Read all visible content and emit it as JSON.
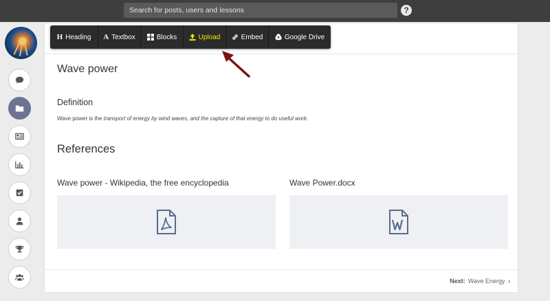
{
  "header": {
    "search_placeholder": "Search for posts, users and lessons",
    "help_label": "?"
  },
  "sidebar": {
    "items": [
      {
        "name": "comments",
        "icon": "comment-icon",
        "active": false
      },
      {
        "name": "lessons",
        "icon": "folder-icon",
        "active": true
      },
      {
        "name": "news",
        "icon": "newspaper-icon",
        "active": false
      },
      {
        "name": "stats",
        "icon": "bar-chart-icon",
        "active": false
      },
      {
        "name": "tasks",
        "icon": "checkbox-icon",
        "active": false
      },
      {
        "name": "profile",
        "icon": "user-icon",
        "active": false
      },
      {
        "name": "awards",
        "icon": "trophy-icon",
        "active": false
      },
      {
        "name": "groups",
        "icon": "users-icon",
        "active": false
      }
    ]
  },
  "toolbar": {
    "heading": {
      "icon": "H",
      "label": "Heading"
    },
    "textbox": {
      "icon": "A",
      "label": "Textbox"
    },
    "blocks": {
      "icon": "grid-icon",
      "label": "Blocks"
    },
    "upload": {
      "icon": "upload-icon",
      "label": "Upload"
    },
    "embed": {
      "icon": "link-icon",
      "label": "Embed"
    },
    "drive": {
      "icon": "drive-icon",
      "label": "Google Drive"
    },
    "highlight_color": "#f3e600"
  },
  "content": {
    "title": "Wave power",
    "definition_heading": "Definition",
    "definition_lead": "Wave power is the ",
    "definition_italic": "transport of energy by wind waves, and the capture of that energy to do useful work.",
    "references_heading": "References",
    "references": [
      {
        "title": "Wave power - Wikipedia, the free encyclopedia",
        "icon": "pdf-file-icon"
      },
      {
        "title": "Wave Power.docx",
        "icon": "word-file-icon"
      }
    ]
  },
  "footer": {
    "next_label": "Next:",
    "next_target": "Wave Energy",
    "next_arrow": "›"
  },
  "colors": {
    "topbar": "#3e3e3e",
    "active_sidebar": "#6b7490",
    "arrow": "#7a1212",
    "file_icon": "#5a6b8c"
  }
}
